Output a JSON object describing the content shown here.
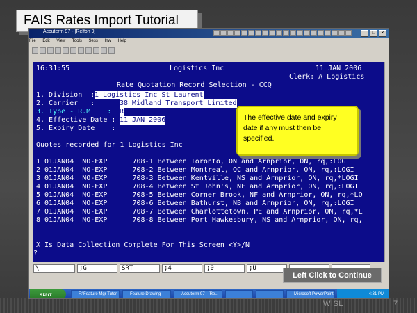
{
  "slide": {
    "title": "FAIS Rates Import Tutorial",
    "callout": "The effective date and expiry date if any must then be specified.",
    "continue_label": "Left Click to Continue",
    "footer_org": "WISL",
    "page_number": "7"
  },
  "window": {
    "title": "Accuterm 97 - [Relfon 9]",
    "menu": [
      "File",
      "Edit",
      "View",
      "Tools",
      "Sess",
      "Inw",
      "Help"
    ],
    "controls": [
      "_",
      "□",
      "×"
    ]
  },
  "terminal": {
    "time": "16:31:55",
    "company": "Logistics Inc",
    "date": "11 JAN 2006",
    "clerk": "Clerk: A Logistics",
    "screen_title": "Rate Quotation Record Selection - CCQ",
    "fields": [
      {
        "label": "1. Division  :",
        "value": "1 Logistics Inc St Laurent"
      },
      {
        "label": "2. Carrier   :",
        "value": "38 Midland Transport Limited"
      },
      {
        "label": "3. Type - R.M    :",
        "value": "R"
      },
      {
        "label": "4. Effective Date :",
        "value": "11 JAN 2006"
      },
      {
        "label": "5. Expiry Date    :",
        "value": ""
      }
    ],
    "quotes_header": "Quotes recorded for 1 Logistics Inc",
    "quotes": [
      "1 01JAN04  NO-EXP      708-1 Between Toronto, ON and Arnprior, ON, rq,:LOGI",
      "2 01JAN04  NO-EXP      708-2 Between Montreal, QC and Arnprior, ON, rq,:LOGI",
      "3 01JAN04  NO-EXP      708-3 Between Kentville, NS and Arnprior, ON, rq,*LOGI",
      "4 01JAN04  NO-EXP      708-4 Between St John's, NF and Arnprior, ON, rq,:LOGI",
      "5 01JAN04  NO-EXP      708-5 Between Corner Brook, NF and Arnprior, ON, rq,*LO",
      "6 01JAN04  NO-EXP      708-6 Between Bathurst, NB and Arnprior, ON, rq,:LOGI",
      "7 01JAN04  NO-EXP      708-7 Between Charlottetown, PE and Arnprior, ON, rq,*L",
      "8 01JAN04  NO-EXP      708-8 Between Port Hawkesbury, NS and Arnprior, ON, rq,"
    ],
    "prompt": "X Is Data Collection Complete For This Screen <Y>/N",
    "prompt2": "?"
  },
  "function_keys": [
    "\\",
    ";G",
    "SRT",
    ";4",
    ";0",
    ";U",
    "",
    ""
  ],
  "taskbar": {
    "start": "start",
    "tasks": [
      "F:\\Feature Mgr Tutorl",
      "Feature Drawing",
      "Accuterm 97 - [Re...",
      "",
      "",
      "Microsoft PowerPoint"
    ],
    "clock": "4:31 PM"
  }
}
